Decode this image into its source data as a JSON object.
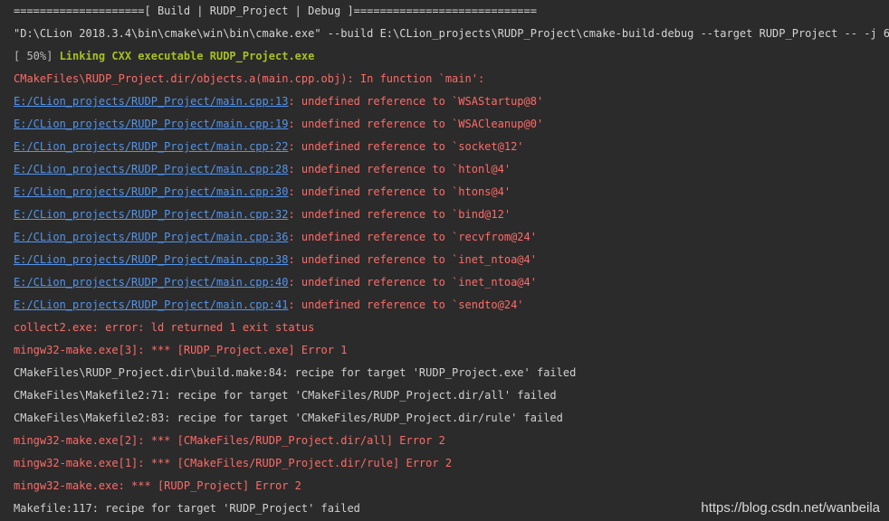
{
  "console": {
    "lines": [
      {
        "kind": "header",
        "text": "====================[ Build | RUDP_Project | Debug ]============================"
      },
      {
        "kind": "command",
        "text": "\"D:\\CLion 2018.3.4\\bin\\cmake\\win\\bin\\cmake.exe\" --build E:\\CLion_projects\\RUDP_Project\\cmake-build-debug --target RUDP_Project -- -j 6"
      },
      {
        "kind": "progress",
        "prefix": "[ 50%] ",
        "text": "Linking CXX executable RUDP_Project.exe"
      },
      {
        "kind": "error",
        "text": "CMakeFiles\\RUDP_Project.dir/objects.a(main.cpp.obj): In function `main':"
      },
      {
        "kind": "link",
        "link": "E:/CLion_projects/RUDP_Project/main.cpp:13",
        "text": ": undefined reference to `WSAStartup@8'"
      },
      {
        "kind": "link",
        "link": "E:/CLion_projects/RUDP_Project/main.cpp:19",
        "text": ": undefined reference to `WSACleanup@0'"
      },
      {
        "kind": "link",
        "link": "E:/CLion_projects/RUDP_Project/main.cpp:22",
        "text": ": undefined reference to `socket@12'"
      },
      {
        "kind": "link",
        "link": "E:/CLion_projects/RUDP_Project/main.cpp:28",
        "text": ": undefined reference to `htonl@4'"
      },
      {
        "kind": "link",
        "link": "E:/CLion_projects/RUDP_Project/main.cpp:30",
        "text": ": undefined reference to `htons@4'"
      },
      {
        "kind": "link",
        "link": "E:/CLion_projects/RUDP_Project/main.cpp:32",
        "text": ": undefined reference to `bind@12'"
      },
      {
        "kind": "link",
        "link": "E:/CLion_projects/RUDP_Project/main.cpp:36",
        "text": ": undefined reference to `recvfrom@24'"
      },
      {
        "kind": "link",
        "link": "E:/CLion_projects/RUDP_Project/main.cpp:38",
        "text": ": undefined reference to `inet_ntoa@4'"
      },
      {
        "kind": "link",
        "link": "E:/CLion_projects/RUDP_Project/main.cpp:40",
        "text": ": undefined reference to `inet_ntoa@4'"
      },
      {
        "kind": "link",
        "link": "E:/CLion_projects/RUDP_Project/main.cpp:41",
        "text": ": undefined reference to `sendto@24'"
      },
      {
        "kind": "error",
        "text": "collect2.exe: error: ld returned 1 exit status"
      },
      {
        "kind": "error",
        "text": "mingw32-make.exe[3]: *** [RUDP_Project.exe] Error 1"
      },
      {
        "kind": "normal",
        "text": "CMakeFiles\\RUDP_Project.dir\\build.make:84: recipe for target 'RUDP_Project.exe' failed"
      },
      {
        "kind": "normal",
        "text": "CMakeFiles\\Makefile2:71: recipe for target 'CMakeFiles/RUDP_Project.dir/all' failed"
      },
      {
        "kind": "normal",
        "text": "CMakeFiles\\Makefile2:83: recipe for target 'CMakeFiles/RUDP_Project.dir/rule' failed"
      },
      {
        "kind": "error",
        "text": "mingw32-make.exe[2]: *** [CMakeFiles/RUDP_Project.dir/all] Error 2"
      },
      {
        "kind": "error",
        "text": "mingw32-make.exe[1]: *** [CMakeFiles/RUDP_Project.dir/rule] Error 2"
      },
      {
        "kind": "error",
        "text": "mingw32-make.exe: *** [RUDP_Project] Error 2"
      },
      {
        "kind": "normal",
        "text": "Makefile:117: recipe for target 'RUDP_Project' failed"
      }
    ]
  },
  "watermark": "https://blog.csdn.net/wanbeila",
  "colors": {
    "background": "#2b2b2b",
    "error": "#ff6b68",
    "link": "#5394ec",
    "progress": "#a8c023",
    "normal": "#d0d0d0"
  }
}
